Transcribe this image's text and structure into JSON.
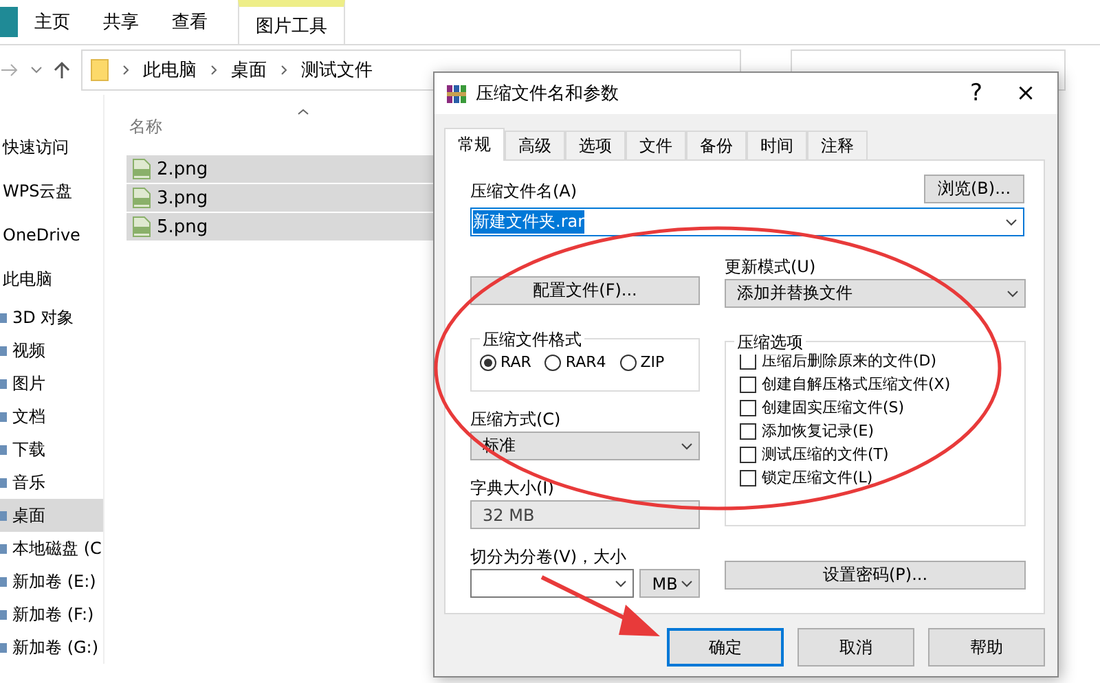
{
  "ribbon_tabs": [
    {
      "label": "主页",
      "kind": "plain",
      "selected": false
    },
    {
      "label": "共享",
      "kind": "plain",
      "selected": false
    },
    {
      "label": "查看",
      "kind": "plain",
      "selected": false
    },
    {
      "label": "图片工具",
      "kind": "context",
      "selected": false
    }
  ],
  "breadcrumb": [
    "此电脑",
    "桌面",
    "测试文件"
  ],
  "sidebar": {
    "items": [
      {
        "label": "快速访问",
        "selected": false,
        "kind": "top"
      },
      {
        "label": "WPS云盘",
        "selected": false,
        "kind": "top"
      },
      {
        "label": "OneDrive",
        "selected": false,
        "kind": "top"
      },
      {
        "label": "此电脑",
        "selected": false,
        "kind": "top"
      },
      {
        "label": "3D 对象",
        "selected": false,
        "kind": "child"
      },
      {
        "label": "视频",
        "selected": false,
        "kind": "child"
      },
      {
        "label": "图片",
        "selected": false,
        "kind": "child"
      },
      {
        "label": "文档",
        "selected": false,
        "kind": "child"
      },
      {
        "label": "下载",
        "selected": false,
        "kind": "child"
      },
      {
        "label": "音乐",
        "selected": false,
        "kind": "child"
      },
      {
        "label": "桌面",
        "selected": true,
        "kind": "child"
      },
      {
        "label": "本地磁盘 (C",
        "selected": false,
        "kind": "child"
      },
      {
        "label": "新加卷 (E:)",
        "selected": false,
        "kind": "child"
      },
      {
        "label": "新加卷 (F:)",
        "selected": false,
        "kind": "child"
      },
      {
        "label": "新加卷 (G:)",
        "selected": false,
        "kind": "child"
      }
    ]
  },
  "file_list": {
    "column": "名称",
    "rows": [
      {
        "name": "2.png",
        "selected": true
      },
      {
        "name": "3.png",
        "selected": true
      },
      {
        "name": "5.png",
        "selected": true
      }
    ]
  },
  "dialog": {
    "title": "压缩文件名和参数",
    "help": "?",
    "close": "×",
    "tabs": [
      {
        "label": "常规",
        "selected": true
      },
      {
        "label": "高级",
        "selected": false
      },
      {
        "label": "选项",
        "selected": false
      },
      {
        "label": "文件",
        "selected": false
      },
      {
        "label": "备份",
        "selected": false
      },
      {
        "label": "时间",
        "selected": false
      },
      {
        "label": "注释",
        "selected": false
      }
    ],
    "archive_name_label": "压缩文件名(A)",
    "browse_button": "浏览(B)...",
    "archive_name": "新建文件夹.rar",
    "profiles_button": "配置文件(F)...",
    "update_mode_label": "更新模式(U)",
    "update_mode": "添加并替换文件",
    "format_group": "压缩文件格式",
    "formats": [
      {
        "label": "RAR",
        "selected": true
      },
      {
        "label": "RAR4",
        "selected": false
      },
      {
        "label": "ZIP",
        "selected": false
      }
    ],
    "method_label": "压缩方式(C)",
    "method": "标准",
    "dictionary_label": "字典大小(I)",
    "dictionary": {
      "value": "32 MB",
      "disabled": true
    },
    "split_label": "切分为分卷(V)，大小",
    "split_unit": "MB",
    "options_group": "压缩选项",
    "options": [
      {
        "label": "压缩后删除原来的文件(D)",
        "checked": false
      },
      {
        "label": "创建自解压格式压缩文件(X)",
        "checked": false
      },
      {
        "label": "创建固实压缩文件(S)",
        "checked": false
      },
      {
        "label": "添加恢复记录(E)",
        "checked": false
      },
      {
        "label": "测试压缩的文件(T)",
        "checked": false
      },
      {
        "label": "锁定压缩文件(L)",
        "checked": false
      }
    ],
    "password_button": "设置密码(P)...",
    "buttons": [
      {
        "label": "确定",
        "default": true
      },
      {
        "label": "取消",
        "default": false
      },
      {
        "label": "帮助",
        "default": false
      }
    ]
  },
  "annotations": {
    "ellipse": true,
    "arrow": true
  }
}
